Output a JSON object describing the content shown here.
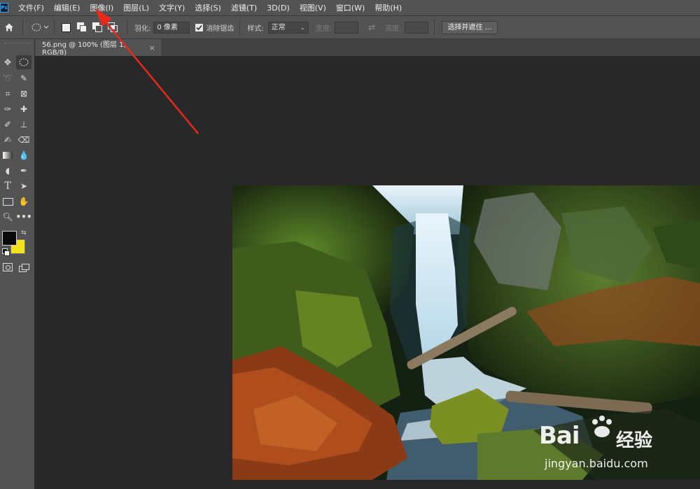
{
  "app": {
    "logo_text": "Ps"
  },
  "menubar": {
    "items": [
      "文件(F)",
      "编辑(E)",
      "图像(I)",
      "图层(L)",
      "文字(Y)",
      "选择(S)",
      "滤镜(T)",
      "3D(D)",
      "视图(V)",
      "窗口(W)",
      "帮助(H)"
    ]
  },
  "options": {
    "feather_label": "羽化:",
    "feather_value": "0 像素",
    "antialias_label": "消除锯齿",
    "antialias_checked": true,
    "style_label": "样式:",
    "style_value": "正常",
    "width_label": "宽度:",
    "height_label": "高度:",
    "select_mask_button": "选择并遮住 ..."
  },
  "document": {
    "tab_title": "56.png @ 100% (图层 1, RGB/8)",
    "tab_close": "×"
  },
  "colors": {
    "foreground": "#0a0a0a",
    "background": "#f2e21b",
    "annotation_arrow": "#e8291c"
  },
  "watermark": {
    "brand": "Bai",
    "brand2": "经验",
    "url": "jingyan.baidu.com"
  }
}
